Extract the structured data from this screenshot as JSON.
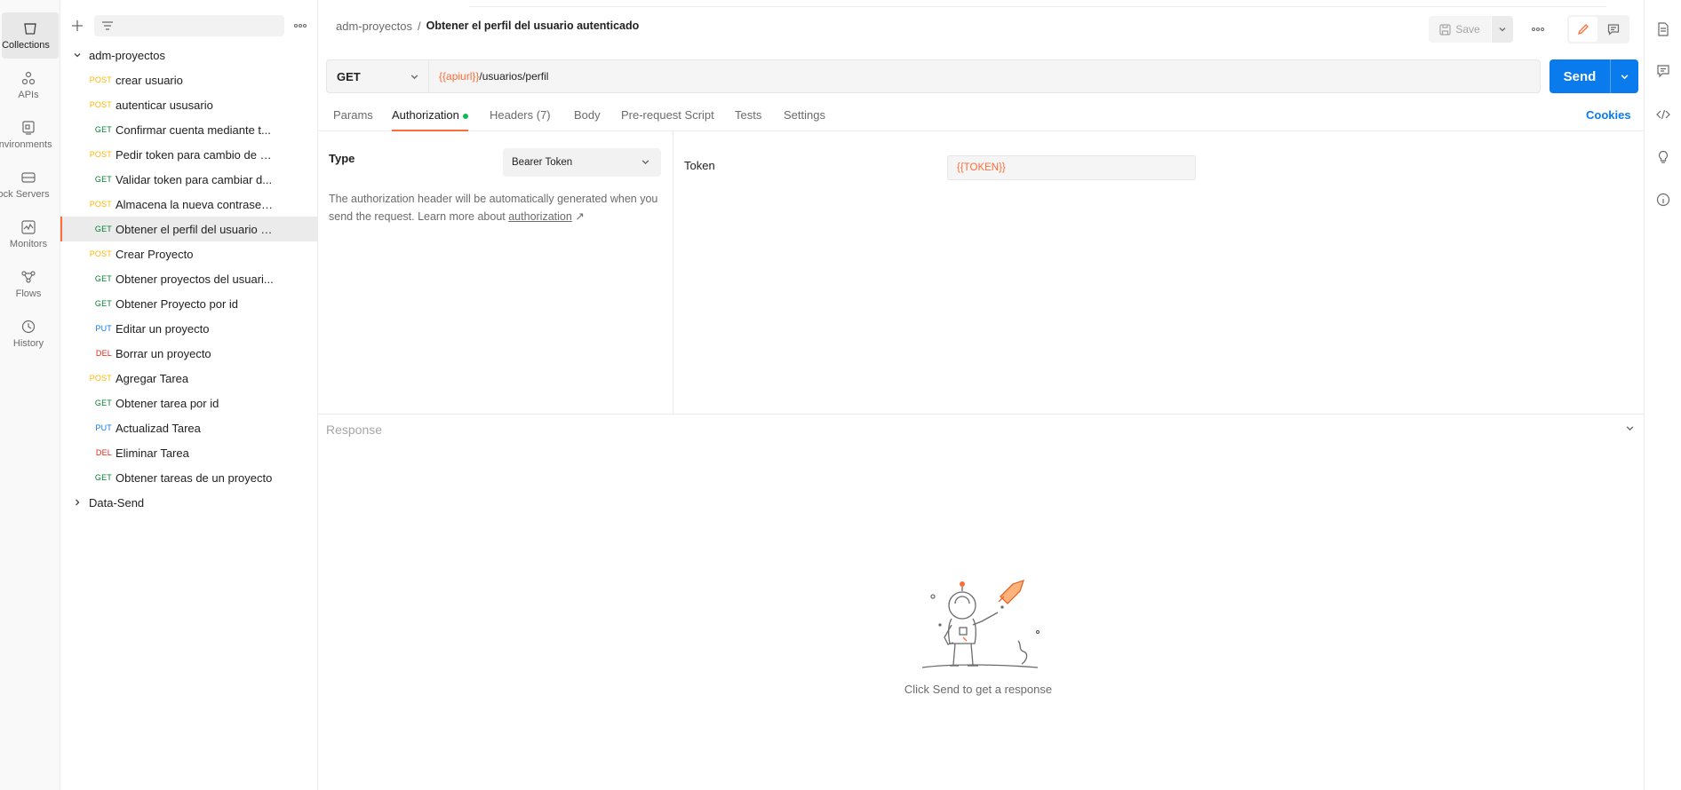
{
  "rail": {
    "items": [
      {
        "label": "Collections",
        "icon": "trash-can-icon"
      },
      {
        "label": "APIs",
        "icon": "apis-icon"
      },
      {
        "label": "Environments",
        "icon": "environment-icon"
      },
      {
        "label": "Mock Servers",
        "icon": "server-icon"
      },
      {
        "label": "Monitors",
        "icon": "monitor-icon"
      },
      {
        "label": "Flows",
        "icon": "flows-icon"
      },
      {
        "label": "History",
        "icon": "history-icon"
      }
    ]
  },
  "sidebar": {
    "collections": [
      {
        "name": "adm-proyectos",
        "expanded": true
      },
      {
        "name": "Data-Send",
        "expanded": false
      }
    ],
    "requests": [
      {
        "method": "POST",
        "name": "crear usuario"
      },
      {
        "method": "POST",
        "name": "autenticar ususario"
      },
      {
        "method": "GET",
        "name": "Confirmar cuenta mediante t..."
      },
      {
        "method": "POST",
        "name": "Pedir token para cambio de c..."
      },
      {
        "method": "GET",
        "name": "Validar token para cambiar d..."
      },
      {
        "method": "POST",
        "name": "Almacena la nueva contraseña"
      },
      {
        "method": "GET",
        "name": "Obtener el perfil del usuario a..."
      },
      {
        "method": "POST",
        "name": "Crear Proyecto"
      },
      {
        "method": "GET",
        "name": "Obtener proyectos del usuari..."
      },
      {
        "method": "GET",
        "name": "Obtener Proyecto por id"
      },
      {
        "method": "PUT",
        "name": "Editar un proyecto"
      },
      {
        "method": "DEL",
        "name": "Borrar un proyecto"
      },
      {
        "method": "POST",
        "name": "Agregar Tarea"
      },
      {
        "method": "GET",
        "name": "Obtener tarea por id"
      },
      {
        "method": "PUT",
        "name": "Actualizad Tarea"
      },
      {
        "method": "DEL",
        "name": "Eliminar Tarea"
      },
      {
        "method": "GET",
        "name": "Obtener tareas de un proyecto"
      }
    ]
  },
  "header": {
    "collection": "adm-proyectos",
    "separator": "/",
    "request_name": "Obtener el perfil del usuario autenticado",
    "save_label": "Save"
  },
  "request": {
    "method": "GET",
    "url_variable": "{{apiurl}}",
    "url_path": "/usuarios/perfil",
    "send_label": "Send"
  },
  "tabs": [
    {
      "label": "Params"
    },
    {
      "label": "Authorization"
    },
    {
      "label": "Headers (7)"
    },
    {
      "label": "Body"
    },
    {
      "label": "Pre-request Script"
    },
    {
      "label": "Tests"
    },
    {
      "label": "Settings"
    }
  ],
  "cookies_label": "Cookies",
  "auth": {
    "type_label": "Type",
    "type_value": "Bearer Token",
    "help_text": "The authorization header will be automatically generated when you send the request. Learn more about",
    "help_link": "authorization",
    "link_arrow": "↗",
    "token_label": "Token",
    "token_value": "{{TOKEN}}"
  },
  "response": {
    "label": "Response",
    "empty_text": "Click Send to get a response"
  },
  "colors": {
    "accent": "#ff6c37",
    "primary": "#097bed",
    "post": "#ffb400",
    "get": "#007f31",
    "put": "#097bed",
    "del": "#eb2013"
  }
}
